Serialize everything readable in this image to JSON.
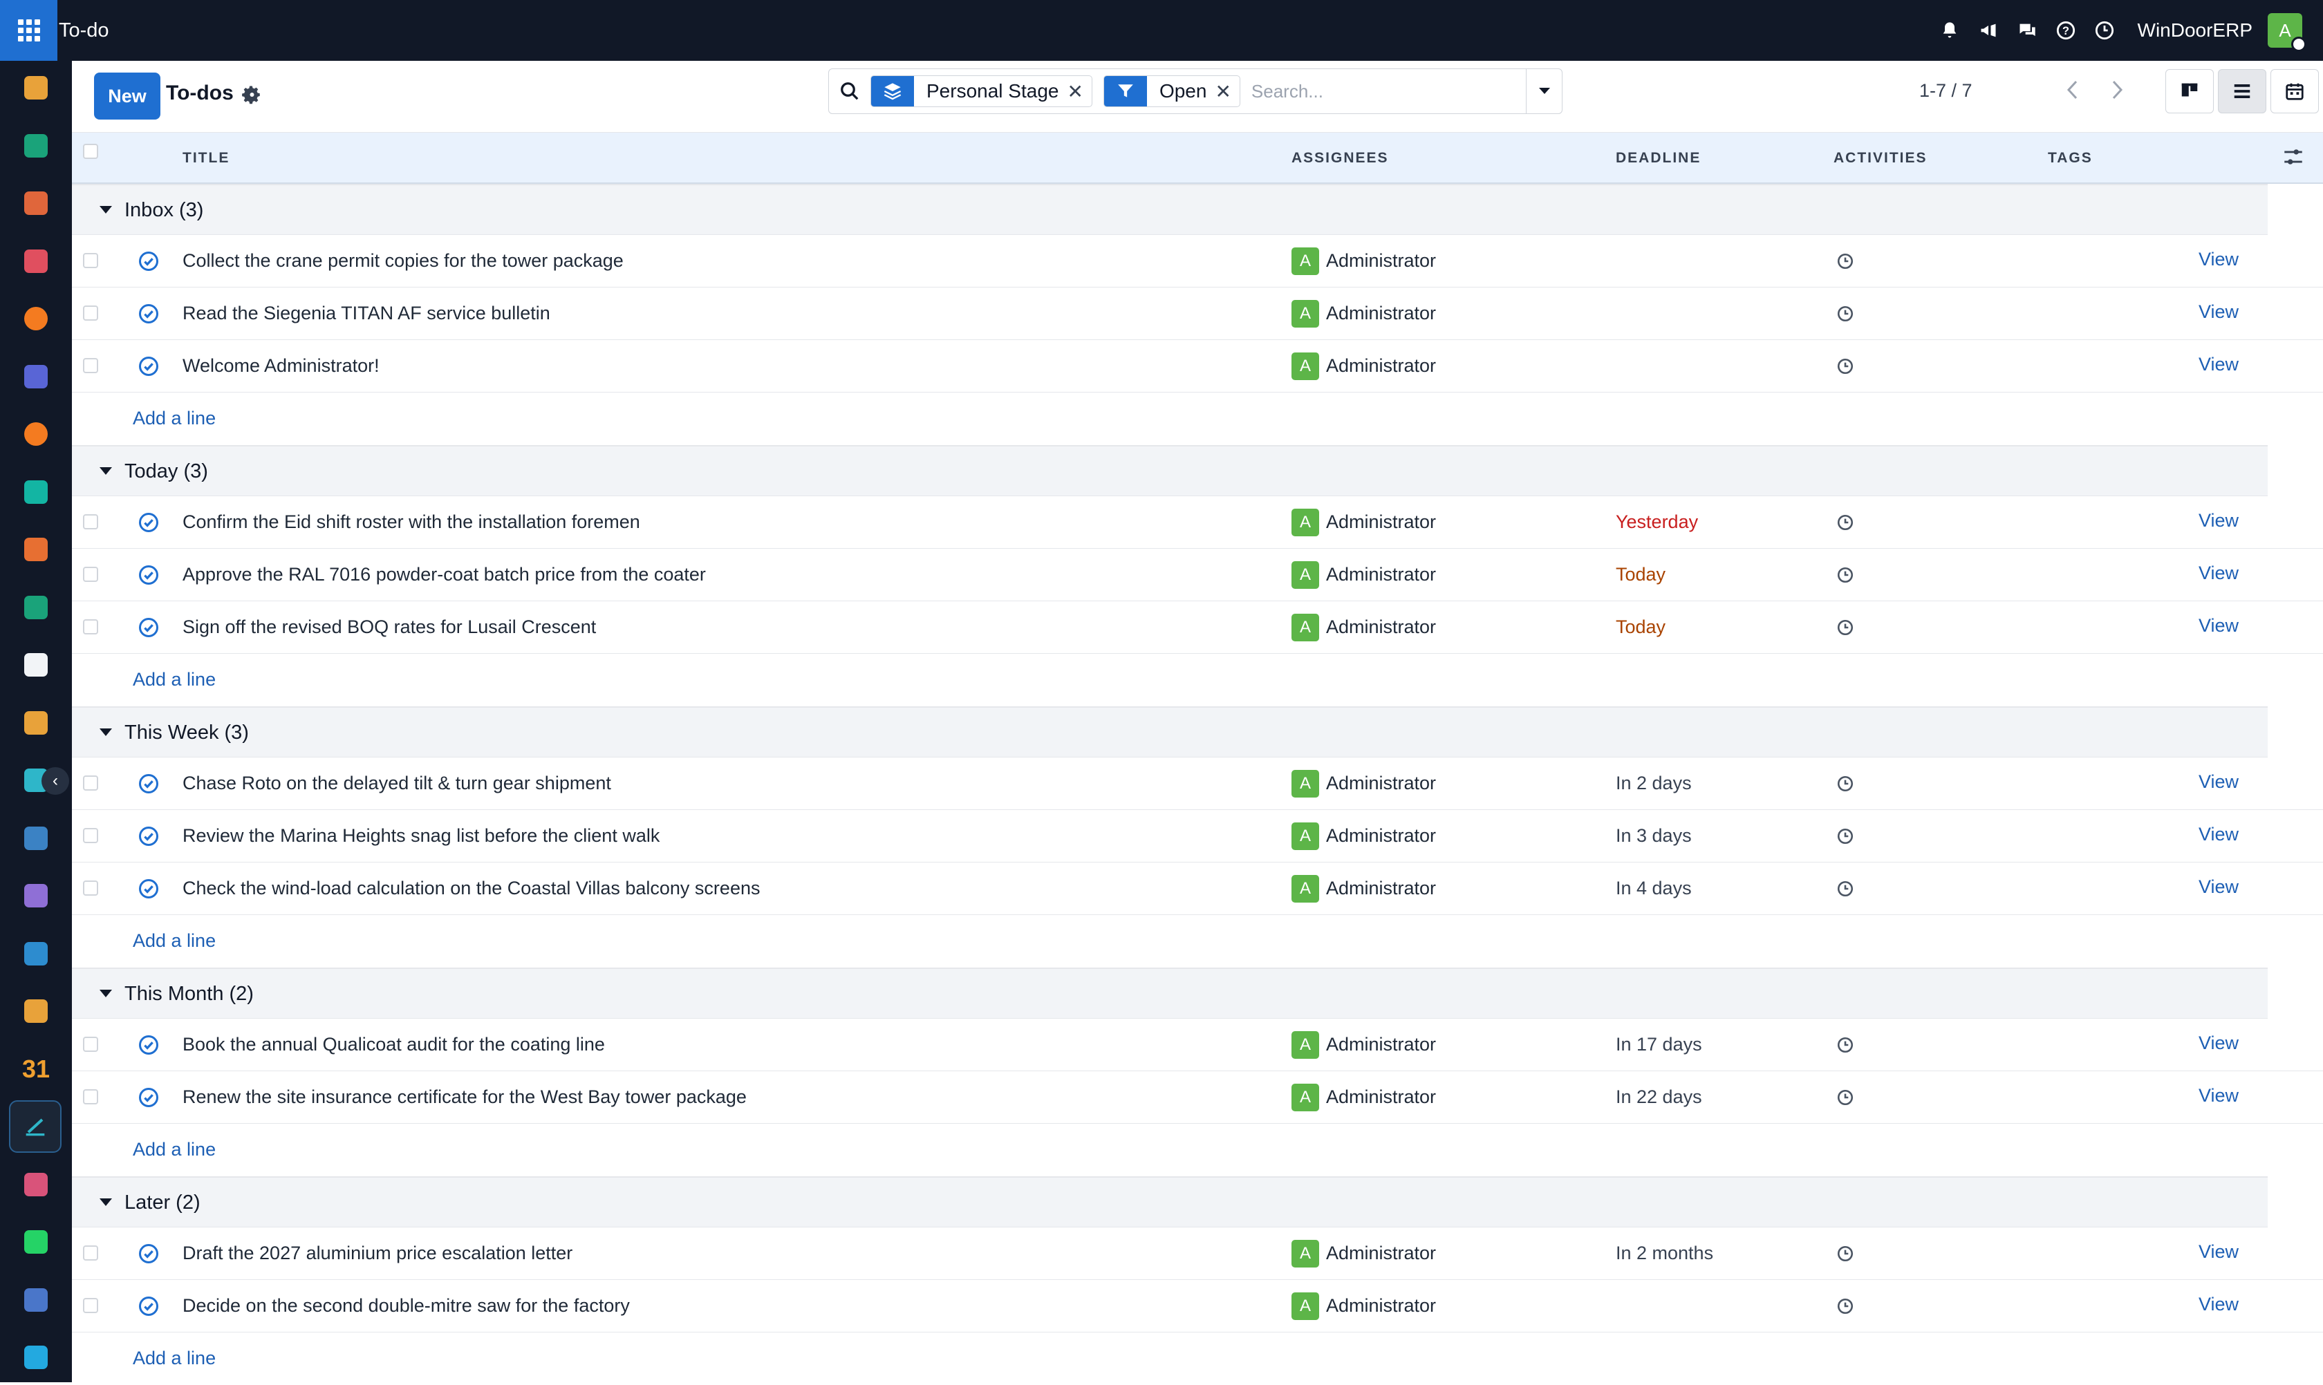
{
  "navbar": {
    "app_title": "To-do",
    "company": "WinDoorERP",
    "avatar_initial": "A"
  },
  "sidebar": {
    "apps": [
      {
        "icon": "documents-icon",
        "color": "#e8a23a"
      },
      {
        "icon": "contacts-icon",
        "color": "#1aa37a"
      },
      {
        "icon": "reporting-icon",
        "color": "#e0663b"
      },
      {
        "icon": "dashboards-icon",
        "color": "#e04f5f"
      },
      {
        "icon": "discuss-icon",
        "color": "#f47b20"
      },
      {
        "icon": "email-marketing-icon",
        "color": "#5965d6"
      },
      {
        "icon": "livechat-icon",
        "color": "#f47b20"
      },
      {
        "icon": "crm-icon",
        "color": "#13b5a3"
      },
      {
        "icon": "spreadsheet-icon",
        "color": "#e76f32"
      },
      {
        "icon": "employees-icon",
        "color": "#1aa37a"
      },
      {
        "icon": "inventory-icon",
        "color": "#f2f4f7"
      },
      {
        "icon": "project-icon",
        "color": "#e8a23a"
      },
      {
        "icon": "todo-check-icon",
        "color": "#2eb6c9"
      },
      {
        "icon": "knowledge-icon",
        "color": "#3b82c4"
      },
      {
        "icon": "manufacturing-icon",
        "color": "#8f6fd6"
      },
      {
        "icon": "invoicing-icon",
        "color": "#2d8ccf"
      },
      {
        "icon": "team-icon",
        "color": "#e8a23a"
      },
      {
        "icon": "calendar-icon",
        "color": "#f0a030"
      },
      {
        "icon": "todo-app-icon",
        "color": "#2eb6c9"
      },
      {
        "icon": "apps-icon",
        "color": "#d9537a"
      },
      {
        "icon": "whatsapp-icon",
        "color": "#25d366"
      },
      {
        "icon": "time-off-icon",
        "color": "#4a76c9"
      },
      {
        "icon": "website-icon",
        "color": "#23a9e0"
      }
    ],
    "calendar_label": "31"
  },
  "control": {
    "new_label": "New",
    "title": "To-dos",
    "facets": [
      {
        "icon": "group-by-icon",
        "label": "Personal Stage"
      },
      {
        "icon": "filter-icon",
        "label": "Open"
      }
    ],
    "search_placeholder": "Search...",
    "pager": "1-7 / 7"
  },
  "table": {
    "headers": {
      "title": "TITLE",
      "assignees": "ASSIGNEES",
      "deadline": "DEADLINE",
      "activities": "ACTIVITIES",
      "tags": "TAGS"
    },
    "add_line_label": "Add a line",
    "view_label": "View",
    "groups": [
      {
        "label": "Inbox (3)",
        "rows": [
          {
            "title": "Collect the crane permit copies for the tower package",
            "assignee": "Administrator",
            "initial": "A",
            "deadline": "",
            "deadline_status": "none"
          },
          {
            "title": "Read the Siegenia TITAN AF service bulletin",
            "assignee": "Administrator",
            "initial": "A",
            "deadline": "",
            "deadline_status": "none"
          },
          {
            "title": "Welcome Administrator!",
            "assignee": "Administrator",
            "initial": "A",
            "deadline": "",
            "deadline_status": "none"
          }
        ]
      },
      {
        "label": "Today (3)",
        "rows": [
          {
            "title": "Confirm the Eid shift roster with the installation foremen",
            "assignee": "Administrator",
            "initial": "A",
            "deadline": "Yesterday",
            "deadline_status": "overdue"
          },
          {
            "title": "Approve the RAL 7016 powder-coat batch price from the coater",
            "assignee": "Administrator",
            "initial": "A",
            "deadline": "Today",
            "deadline_status": "today"
          },
          {
            "title": "Sign off the revised BOQ rates for Lusail Crescent",
            "assignee": "Administrator",
            "initial": "A",
            "deadline": "Today",
            "deadline_status": "today"
          }
        ]
      },
      {
        "label": "This Week (3)",
        "rows": [
          {
            "title": "Chase Roto on the delayed tilt & turn gear shipment",
            "assignee": "Administrator",
            "initial": "A",
            "deadline": "In 2 days",
            "deadline_status": "future"
          },
          {
            "title": "Review the Marina Heights snag list before the client walk",
            "assignee": "Administrator",
            "initial": "A",
            "deadline": "In 3 days",
            "deadline_status": "future"
          },
          {
            "title": "Check the wind-load calculation on the Coastal Villas balcony screens",
            "assignee": "Administrator",
            "initial": "A",
            "deadline": "In 4 days",
            "deadline_status": "future"
          }
        ]
      },
      {
        "label": "This Month (2)",
        "rows": [
          {
            "title": "Book the annual Qualicoat audit for the coating line",
            "assignee": "Administrator",
            "initial": "A",
            "deadline": "In 17 days",
            "deadline_status": "future"
          },
          {
            "title": "Renew the site insurance certificate for the West Bay tower package",
            "assignee": "Administrator",
            "initial": "A",
            "deadline": "In 22 days",
            "deadline_status": "future"
          }
        ]
      },
      {
        "label": "Later (2)",
        "rows": [
          {
            "title": "Draft the 2027 aluminium price escalation letter",
            "assignee": "Administrator",
            "initial": "A",
            "deadline": "In 2 months",
            "deadline_status": "future"
          },
          {
            "title": "Decide on the second double-mitre saw for the factory",
            "assignee": "Administrator",
            "initial": "A",
            "deadline": "",
            "deadline_status": "none"
          }
        ]
      }
    ]
  }
}
